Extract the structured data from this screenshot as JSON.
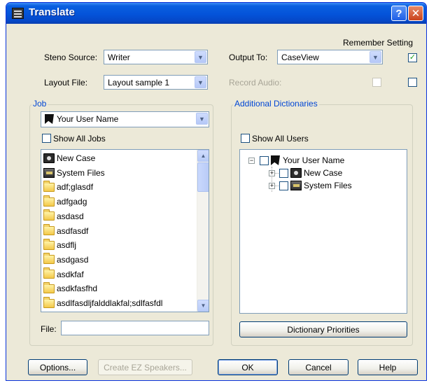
{
  "window": {
    "title": "Translate",
    "help_glyph": "?",
    "close_glyph": "✕"
  },
  "remember_setting": {
    "label": "Remember Setting",
    "checked": true
  },
  "steno_source": {
    "label": "Steno Source:",
    "value": "Writer"
  },
  "layout_file": {
    "label": "Layout File:",
    "value": "Layout sample 1"
  },
  "output_to": {
    "label": "Output To:",
    "value": "CaseView"
  },
  "record_audio": {
    "label": "Record Audio:",
    "enabled": false
  },
  "job": {
    "group_title": "Job",
    "user_value": "Your User Name",
    "show_all_jobs": "Show All Jobs",
    "items": [
      {
        "label": "New Case",
        "icon": "case-icon"
      },
      {
        "label": "System Files",
        "icon": "system-files-icon"
      },
      {
        "label": "adf;glasdf",
        "icon": "folder-icon"
      },
      {
        "label": "adfgadg",
        "icon": "folder-icon"
      },
      {
        "label": "asdasd",
        "icon": "folder-icon"
      },
      {
        "label": "asdfasdf",
        "icon": "folder-icon"
      },
      {
        "label": "asdflj",
        "icon": "folder-icon"
      },
      {
        "label": "asdgasd",
        "icon": "folder-icon"
      },
      {
        "label": "asdkfaf",
        "icon": "folder-icon"
      },
      {
        "label": "asdkfasfhd",
        "icon": "folder-icon"
      },
      {
        "label": "asdlfasdljfalddlakfal;sdlfasfdl",
        "icon": "folder-icon"
      }
    ],
    "file_label": "File:",
    "file_value": ""
  },
  "dictionaries": {
    "group_title": "Additional Dictionaries",
    "show_all_users": "Show All Users",
    "tree": {
      "root": {
        "label": "Your User Name",
        "expander": "⊟"
      },
      "children": [
        {
          "label": "New Case",
          "expander": "⊞"
        },
        {
          "label": "System Files",
          "expander": "⊞"
        }
      ]
    },
    "priorities_button": "Dictionary Priorities"
  },
  "buttons": {
    "options": "Options...",
    "create_ez": "Create EZ Speakers...",
    "ok": "OK",
    "cancel": "Cancel",
    "help": "Help"
  },
  "colors": {
    "titlebar": "#0453d9",
    "dialog_bg": "#ece9d8",
    "group_title": "#0046d5",
    "check_green": "#21a121"
  }
}
